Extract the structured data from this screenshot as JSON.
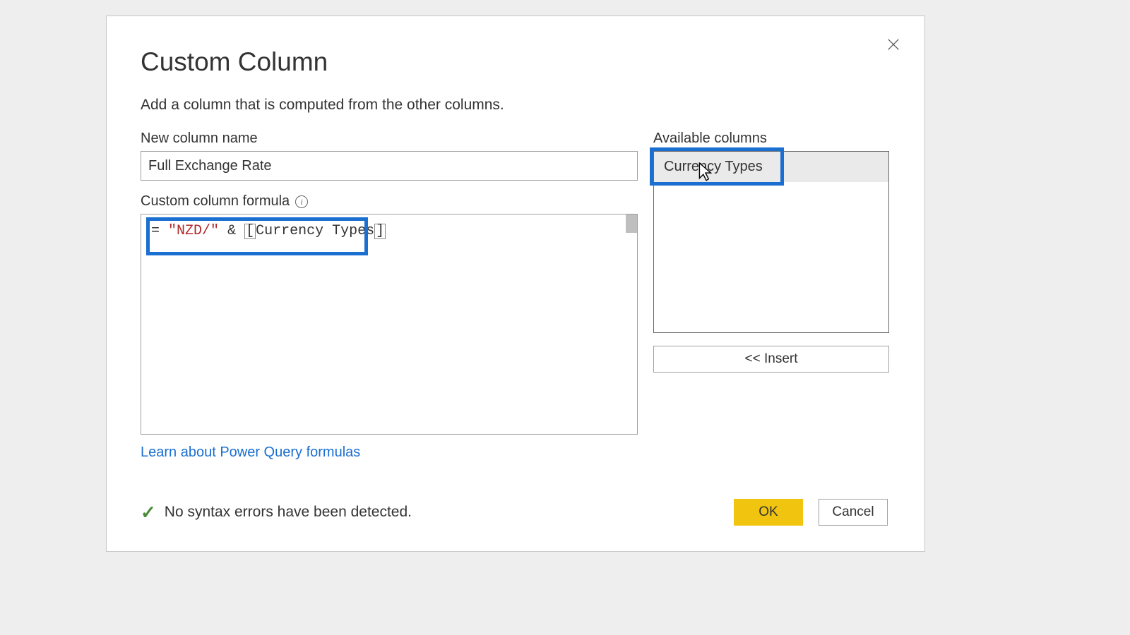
{
  "dialog": {
    "title": "Custom Column",
    "subtitle": "Add a column that is computed from the other columns.",
    "new_column_label": "New column name",
    "new_column_value": "Full Exchange Rate",
    "formula_label": "Custom column formula",
    "formula": {
      "eq": "=",
      "string_literal": "\"NZD/\"",
      "amp": "&",
      "open_br": "[",
      "column_ref": "Currency Types",
      "close_br": "]"
    },
    "available_label": "Available columns",
    "available_items": [
      "Currency Types"
    ],
    "insert_label": "<< Insert",
    "learn_link": "Learn about Power Query formulas",
    "status_text": "No syntax errors have been detected.",
    "ok_label": "OK",
    "cancel_label": "Cancel"
  }
}
